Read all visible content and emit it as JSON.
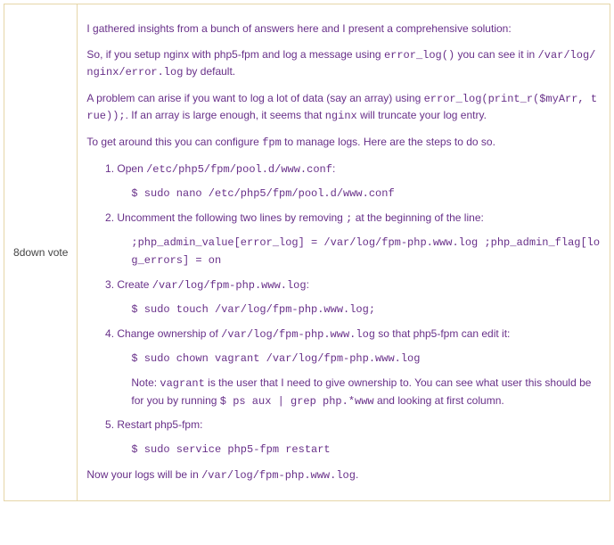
{
  "vote": {
    "count": "8",
    "label": "down vote"
  },
  "post": {
    "intro": "I gathered insights from a bunch of answers here and I present a comprehensive solution:",
    "p2_a": "So, if you setup nginx with php5-fpm and log a message using ",
    "p2_code1": "error_log()",
    "p2_b": " you can see it in ",
    "p2_code2": "/var/log/nginx/error.log",
    "p2_c": " by default.",
    "p3_a": "A problem can arise if you want to log a lot of data (say an array) using ",
    "p3_code1": "error_log(print_r($myArr, true));",
    "p3_b": ". If an array is large enough, it seems that ",
    "p3_code2": "nginx",
    "p3_c": " will truncate your log entry.",
    "p4_a": "To get around this you can configure ",
    "p4_code1": "fpm",
    "p4_b": " to manage logs. Here are the steps to do so.",
    "steps": {
      "s1_a": "Open ",
      "s1_code1": "/etc/php5/fpm/pool.d/www.conf",
      "s1_b": ":",
      "s1_cmd": "$ sudo nano /etc/php5/fpm/pool.d/www.conf",
      "s2_a": "Uncomment the following two lines by removing ",
      "s2_code1": ";",
      "s2_b": " at the beginning of the line:",
      "s2_cmd": ";php_admin_value[error_log] = /var/log/fpm-php.www.log ;php_admin_flag[log_errors] = on",
      "s3_a": "Create ",
      "s3_code1": "/var/log/fpm-php.www.log",
      "s3_b": ":",
      "s3_cmd": "$ sudo touch /var/log/fpm-php.www.log;",
      "s4_a": "Change ownership of ",
      "s4_code1": "/var/log/fpm-php.www.log",
      "s4_b": " so that php5-fpm can edit it:",
      "s4_cmd": "$ sudo chown vagrant /var/log/fpm-php.www.log",
      "s4_note_a": "Note: ",
      "s4_note_code1": "vagrant",
      "s4_note_b": " is the user that I need to give ownership to. You can see what user this should be for you by running ",
      "s4_note_code2": "$ ps aux | grep php.*www",
      "s4_note_c": " and looking at first column.",
      "s5_a": "Restart php5-fpm:",
      "s5_cmd": "$ sudo service php5-fpm restart"
    },
    "outro_a": "Now your logs will be in ",
    "outro_code": "/var/log/fpm-php.www.log",
    "outro_b": "."
  }
}
